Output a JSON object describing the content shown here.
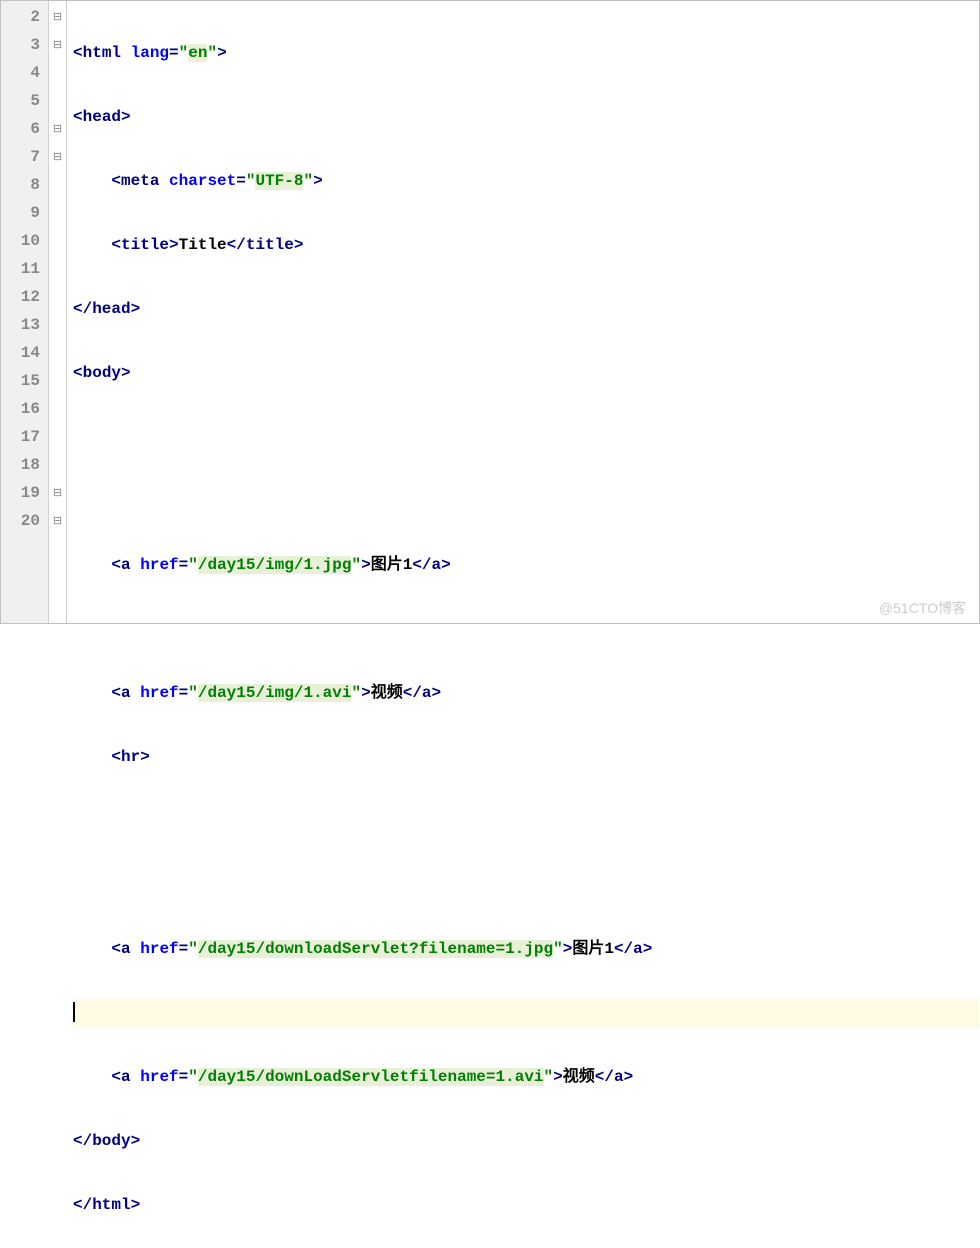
{
  "gutter": {
    "lines": [
      "2",
      "3",
      "4",
      "5",
      "6",
      "7",
      "8",
      "9",
      "10",
      "11",
      "12",
      "13",
      "14",
      "15",
      "16",
      "17",
      "18",
      "19",
      "20"
    ]
  },
  "code": {
    "l2": {
      "indent": "",
      "tag": "html",
      "attr": "lang",
      "val": "en",
      "type": "opentag"
    },
    "l3": {
      "indent": "",
      "tag": "head",
      "type": "opentag-simple"
    },
    "l4": {
      "indent": "    ",
      "tag": "meta",
      "attr": "charset",
      "val": "UTF-8",
      "type": "opentag"
    },
    "l5": {
      "indent": "    ",
      "tag": "title",
      "text": "Title",
      "type": "openclose"
    },
    "l6": {
      "indent": "",
      "tag": "head",
      "type": "closetag"
    },
    "l7": {
      "indent": "",
      "tag": "body",
      "type": "opentag-simple"
    },
    "l10": {
      "indent": "    ",
      "tag": "a",
      "attr": "href",
      "val": "/day15/img/1.jpg",
      "text": "图片1",
      "type": "link"
    },
    "l12": {
      "indent": "    ",
      "tag": "a",
      "attr": "href",
      "val": "/day15/img/1.avi",
      "text": "视频",
      "type": "link"
    },
    "l13": {
      "indent": "    ",
      "tag": "hr",
      "type": "opentag-simple"
    },
    "l16": {
      "indent": "    ",
      "tag": "a",
      "attr": "href",
      "val": "/day15/downloadServlet?filename=1.jpg",
      "text": "图片1",
      "type": "link"
    },
    "l18": {
      "indent": "    ",
      "tag": "a",
      "attr": "href",
      "val": "/day15/downLoadServletfilename=1.avi",
      "text": "视频",
      "type": "link"
    },
    "l19": {
      "indent": "",
      "tag": "body",
      "type": "closetag"
    },
    "l20": {
      "indent": "",
      "tag": "html",
      "type": "closetag"
    }
  },
  "watermark": "@51CTO博客",
  "highlight_line": 17
}
